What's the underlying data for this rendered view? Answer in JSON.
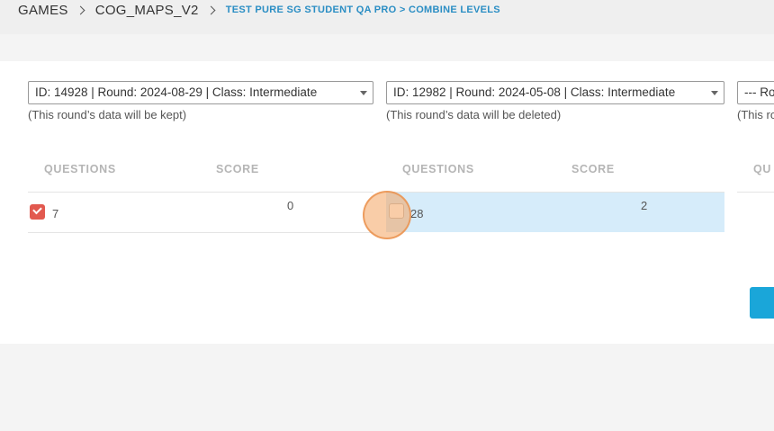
{
  "breadcrumb": {
    "items": [
      "GAMES",
      "COG_MAPS_V2"
    ],
    "current": "TEST PURE SG STUDENT QA PRO > COMBINE LEVELS"
  },
  "rounds": [
    {
      "select_value": "ID: 14928 | Round: 2024-08-29 | Class: Intermediate",
      "note": "(This round’s data will be kept)",
      "col_questions": "QUESTIONS",
      "col_score": "SCORE",
      "row": {
        "checked": true,
        "questions": "7",
        "score": "0"
      }
    },
    {
      "select_value": "ID: 12982 | Round: 2024-05-08 | Class: Intermediate",
      "note": "(This round’s data will be deleted)",
      "col_questions": "QUESTIONS",
      "col_score": "SCORE",
      "row": {
        "checked": false,
        "questions": "28",
        "score": "2",
        "highlighted": true
      }
    },
    {
      "select_value": "--- Ro",
      "note": "(This ro",
      "col_questions": "QU"
    }
  ],
  "colors": {
    "accent": "#2b8ec4",
    "checkbox_checked": "#e2594f",
    "row_highlight": "#d6ecfa",
    "button": "#1aa6d9"
  }
}
